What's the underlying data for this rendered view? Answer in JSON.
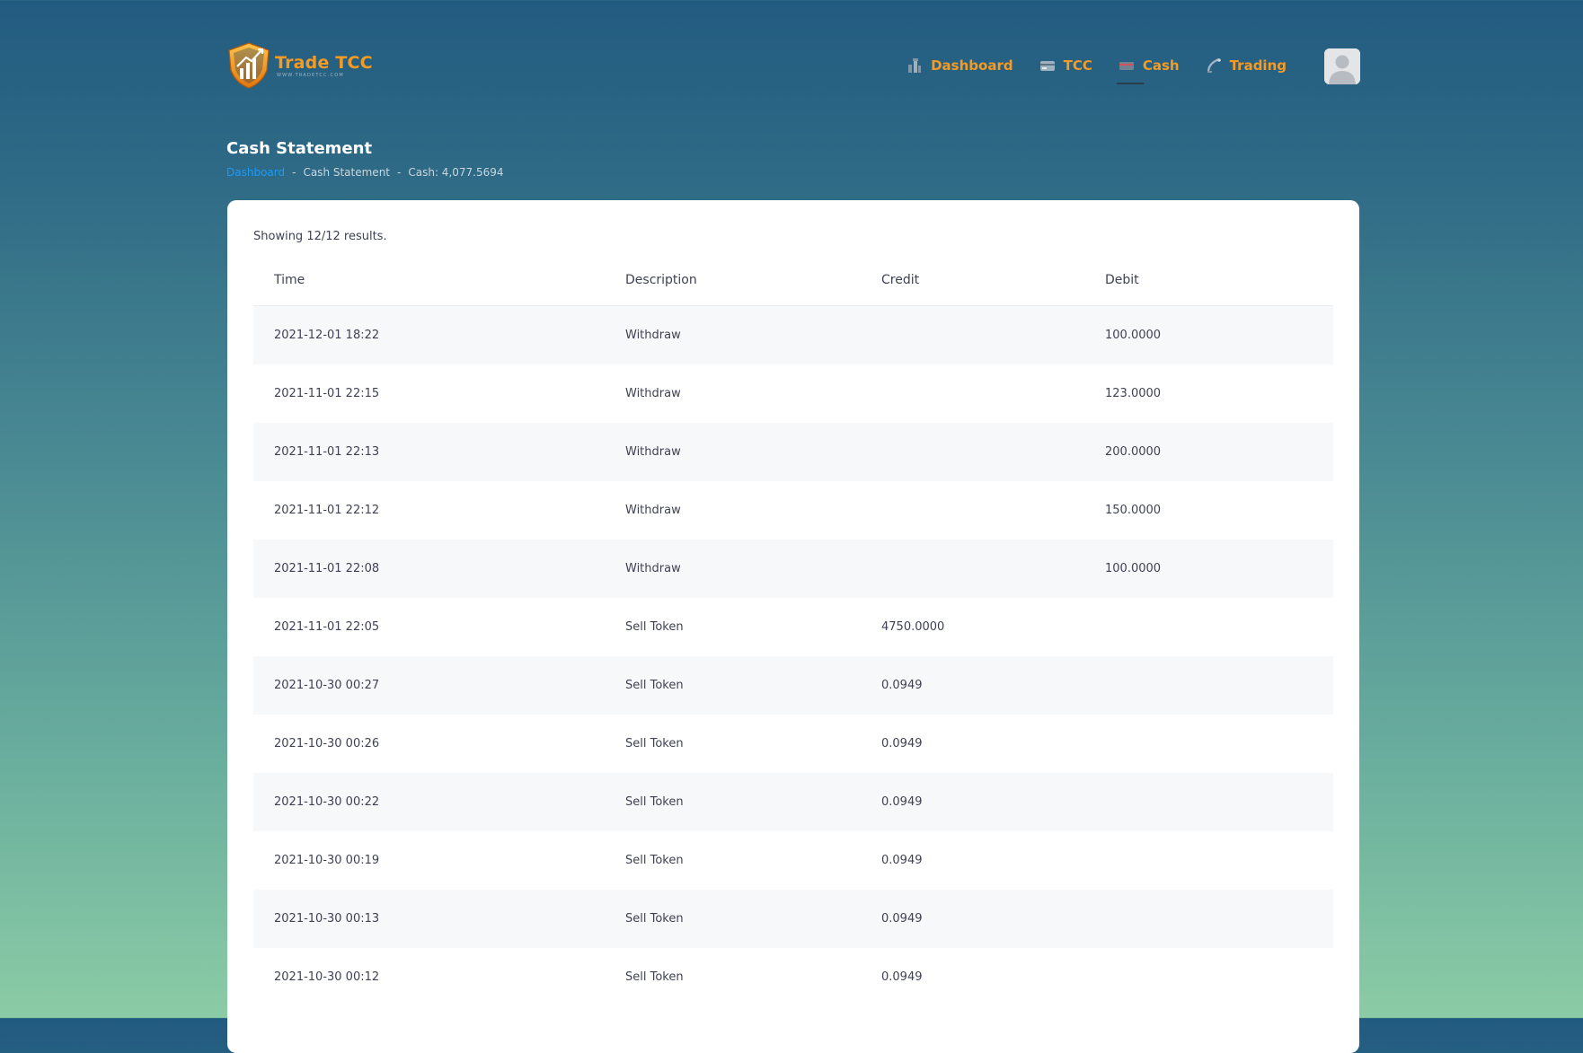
{
  "brand": {
    "name": "Trade TCC",
    "tagline": "WWW.TRADETCC.COM",
    "colors": {
      "accent": "#f59a23",
      "link": "#1e9af5",
      "text": "#3f4254"
    }
  },
  "nav": {
    "items": [
      {
        "label": "Dashboard",
        "icon": "dashboard-icon"
      },
      {
        "label": "TCC",
        "icon": "card-icon"
      },
      {
        "label": "Cash",
        "icon": "cash-icon",
        "active": true
      },
      {
        "label": "Trading",
        "icon": "trading-icon"
      }
    ]
  },
  "page": {
    "title": "Cash Statement",
    "breadcrumb": {
      "home": "Dashboard",
      "current": "Cash Statement",
      "cash": "Cash: 4,077.5694",
      "separator": "-"
    }
  },
  "table": {
    "results_info": "Showing 12/12 results.",
    "columns": [
      "Time",
      "Description",
      "Credit",
      "Debit"
    ],
    "rows": [
      {
        "time": "2021-12-01 18:22",
        "description": "Withdraw",
        "credit": "",
        "debit": "100.0000"
      },
      {
        "time": "2021-11-01 22:15",
        "description": "Withdraw",
        "credit": "",
        "debit": "123.0000"
      },
      {
        "time": "2021-11-01 22:13",
        "description": "Withdraw",
        "credit": "",
        "debit": "200.0000"
      },
      {
        "time": "2021-11-01 22:12",
        "description": "Withdraw",
        "credit": "",
        "debit": "150.0000"
      },
      {
        "time": "2021-11-01 22:08",
        "description": "Withdraw",
        "credit": "",
        "debit": "100.0000"
      },
      {
        "time": "2021-11-01 22:05",
        "description": "Sell Token",
        "credit": "4750.0000",
        "debit": ""
      },
      {
        "time": "2021-10-30 00:27",
        "description": "Sell Token",
        "credit": "0.0949",
        "debit": ""
      },
      {
        "time": "2021-10-30 00:26",
        "description": "Sell Token",
        "credit": "0.0949",
        "debit": ""
      },
      {
        "time": "2021-10-30 00:22",
        "description": "Sell Token",
        "credit": "0.0949",
        "debit": ""
      },
      {
        "time": "2021-10-30 00:19",
        "description": "Sell Token",
        "credit": "0.0949",
        "debit": ""
      },
      {
        "time": "2021-10-30 00:13",
        "description": "Sell Token",
        "credit": "0.0949",
        "debit": ""
      },
      {
        "time": "2021-10-30 00:12",
        "description": "Sell Token",
        "credit": "0.0949",
        "debit": ""
      }
    ]
  }
}
